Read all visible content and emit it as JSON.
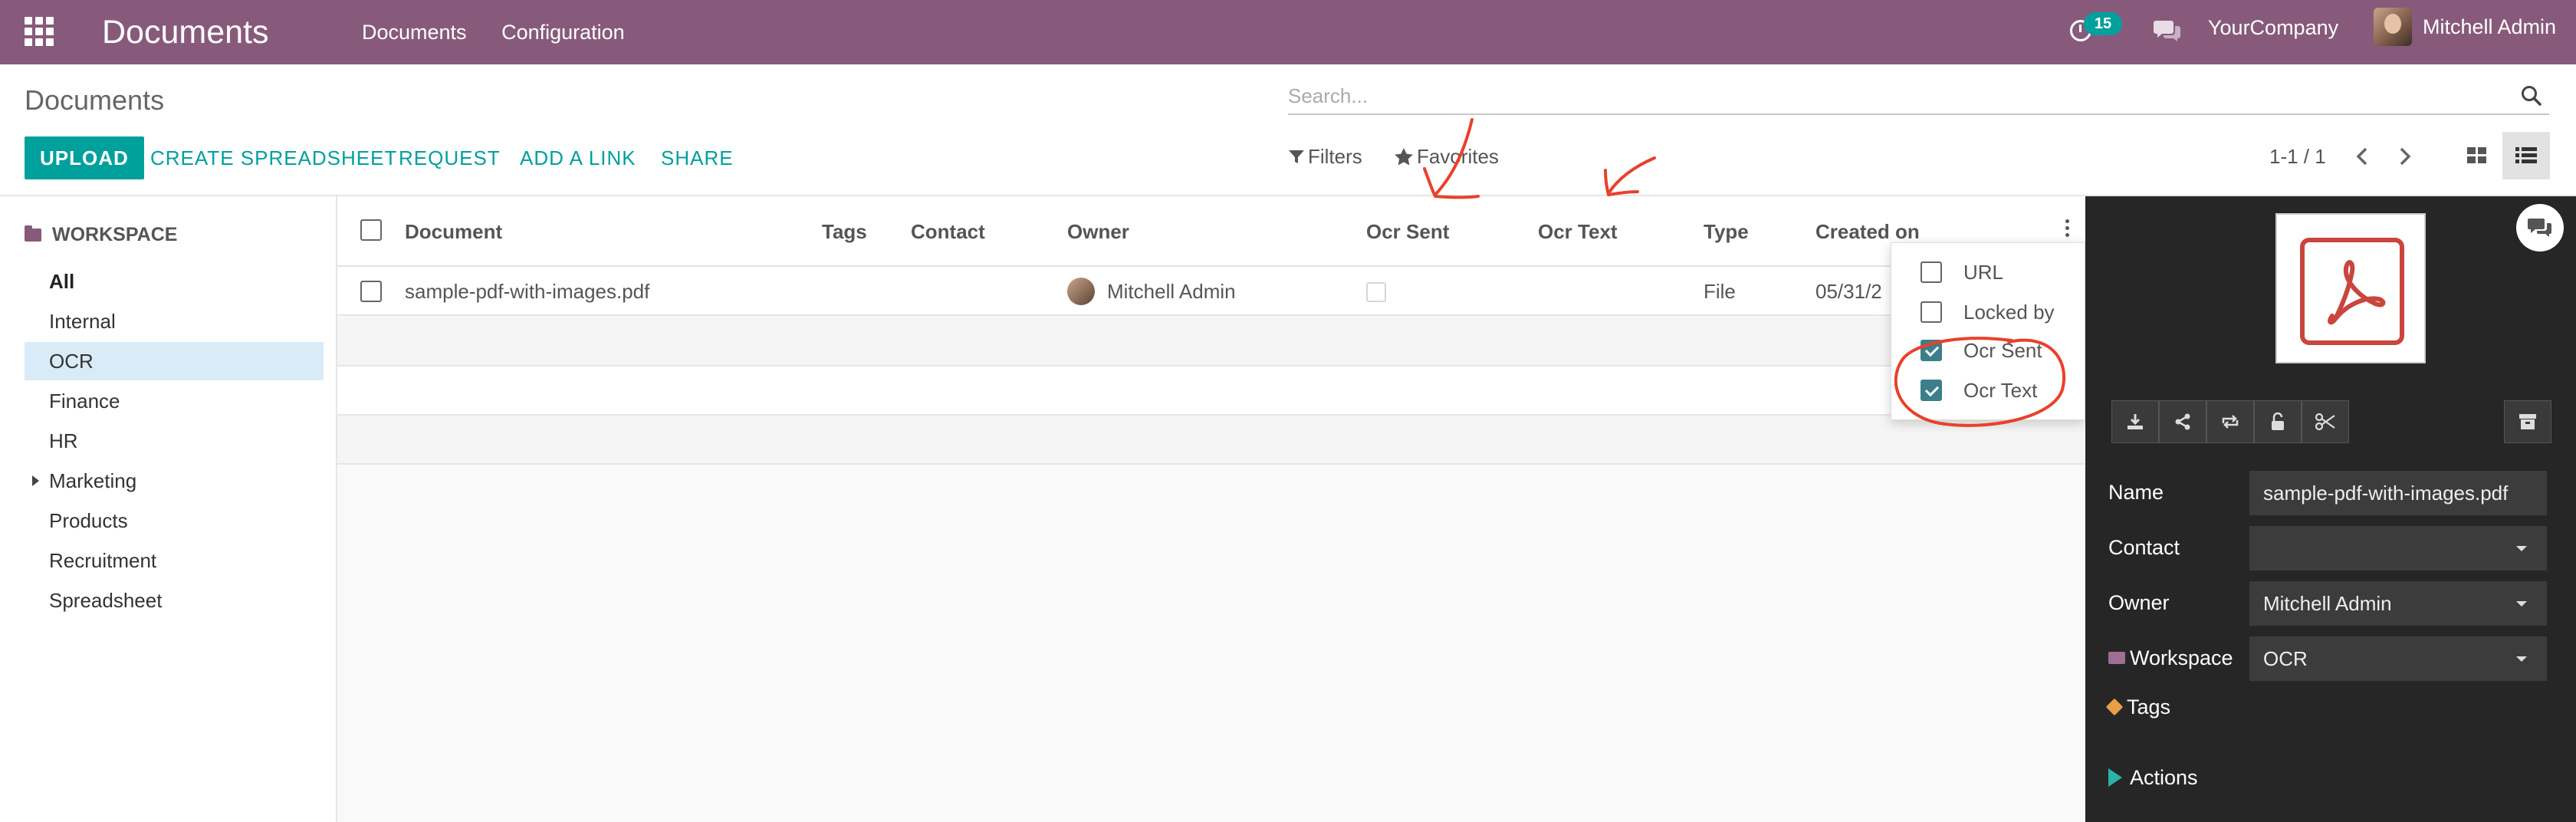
{
  "navbar": {
    "app_title": "Documents",
    "menu": [
      "Documents",
      "Configuration"
    ],
    "activity_count": "15",
    "company": "YourCompany",
    "user": "Mitchell Admin",
    "color": "#875a7b"
  },
  "control_panel": {
    "breadcrumb": "Documents",
    "search_placeholder": "Search...",
    "buttons": {
      "upload": "UPLOAD",
      "create_spreadsheet": "CREATE SPREADSHEET",
      "request": "REQUEST",
      "add_link": "ADD A LINK",
      "share": "SHARE"
    },
    "filters": "Filters",
    "favorites": "Favorites",
    "pager": "1-1 / 1",
    "accent": "#00a09d"
  },
  "sidebar": {
    "header": "WORKSPACE",
    "items": [
      {
        "label": "All"
      },
      {
        "label": "Internal"
      },
      {
        "label": "OCR"
      },
      {
        "label": "Finance"
      },
      {
        "label": "HR"
      },
      {
        "label": "Marketing"
      },
      {
        "label": "Products"
      },
      {
        "label": "Recruitment"
      },
      {
        "label": "Spreadsheet"
      }
    ],
    "selected": "OCR",
    "selected_color": "#d9ebf7"
  },
  "list": {
    "columns": [
      "Document",
      "Tags",
      "Contact",
      "Owner",
      "Ocr Sent",
      "Ocr Text",
      "Type",
      "Created on"
    ],
    "rows": [
      {
        "document": "sample-pdf-with-images.pdf",
        "tags": "",
        "contact": "",
        "owner": "Mitchell Admin",
        "ocr_sent": false,
        "ocr_text": "",
        "type": "File",
        "created_on": "05/31/2"
      }
    ]
  },
  "column_dropdown": {
    "items": [
      {
        "label": "URL",
        "checked": false
      },
      {
        "label": "Locked by",
        "checked": false
      },
      {
        "label": "Ocr Sent",
        "checked": true
      },
      {
        "label": "Ocr Text",
        "checked": true
      }
    ],
    "check_color": "#3d7e8b"
  },
  "annotations": {
    "color": "#e8412c",
    "marks": [
      "arrow-to-ocr-sent-column",
      "arrow-to-ocr-text-column",
      "circle-around-ocr-options"
    ]
  },
  "preview": {
    "fields": {
      "name_label": "Name",
      "name_value": "sample-pdf-with-images.pdf",
      "contact_label": "Contact",
      "contact_value": "",
      "owner_label": "Owner",
      "owner_value": "Mitchell Admin",
      "workspace_label": "Workspace",
      "workspace_value": "OCR",
      "tags_label": "Tags",
      "actions_label": "Actions"
    },
    "tools": [
      "download-icon",
      "share-icon",
      "replace-icon",
      "lock-icon",
      "split-icon"
    ],
    "archive": "archive-icon"
  }
}
